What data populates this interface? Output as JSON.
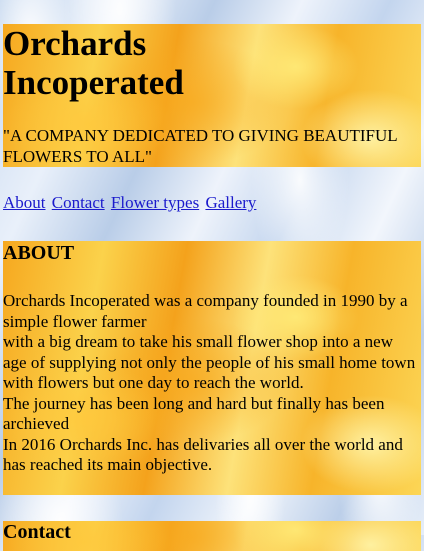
{
  "header": {
    "title": "Orchards Incoperated",
    "tagline": "\"A COMPANY DEDICATED TO GIVING BEAUTIFUL FLOWERS TO ALL\""
  },
  "nav": {
    "links": [
      "About",
      "Contact",
      "Flower types",
      "Gallery"
    ]
  },
  "about": {
    "heading": "ABOUT",
    "lines": [
      "Orchards Incoperated was a company founded in 1990 by a simple flower farmer",
      "with a big dream to take his small flower shop into a new age of supplying not only the people of his small home town",
      "with flowers but one day to reach the world.",
      "The journey has been long and hard but finally has been archieved",
      "In 2016 Orchards Inc. has delivaries all over the world and has reached its main objective."
    ]
  },
  "contact": {
    "heading": "Contact"
  }
}
